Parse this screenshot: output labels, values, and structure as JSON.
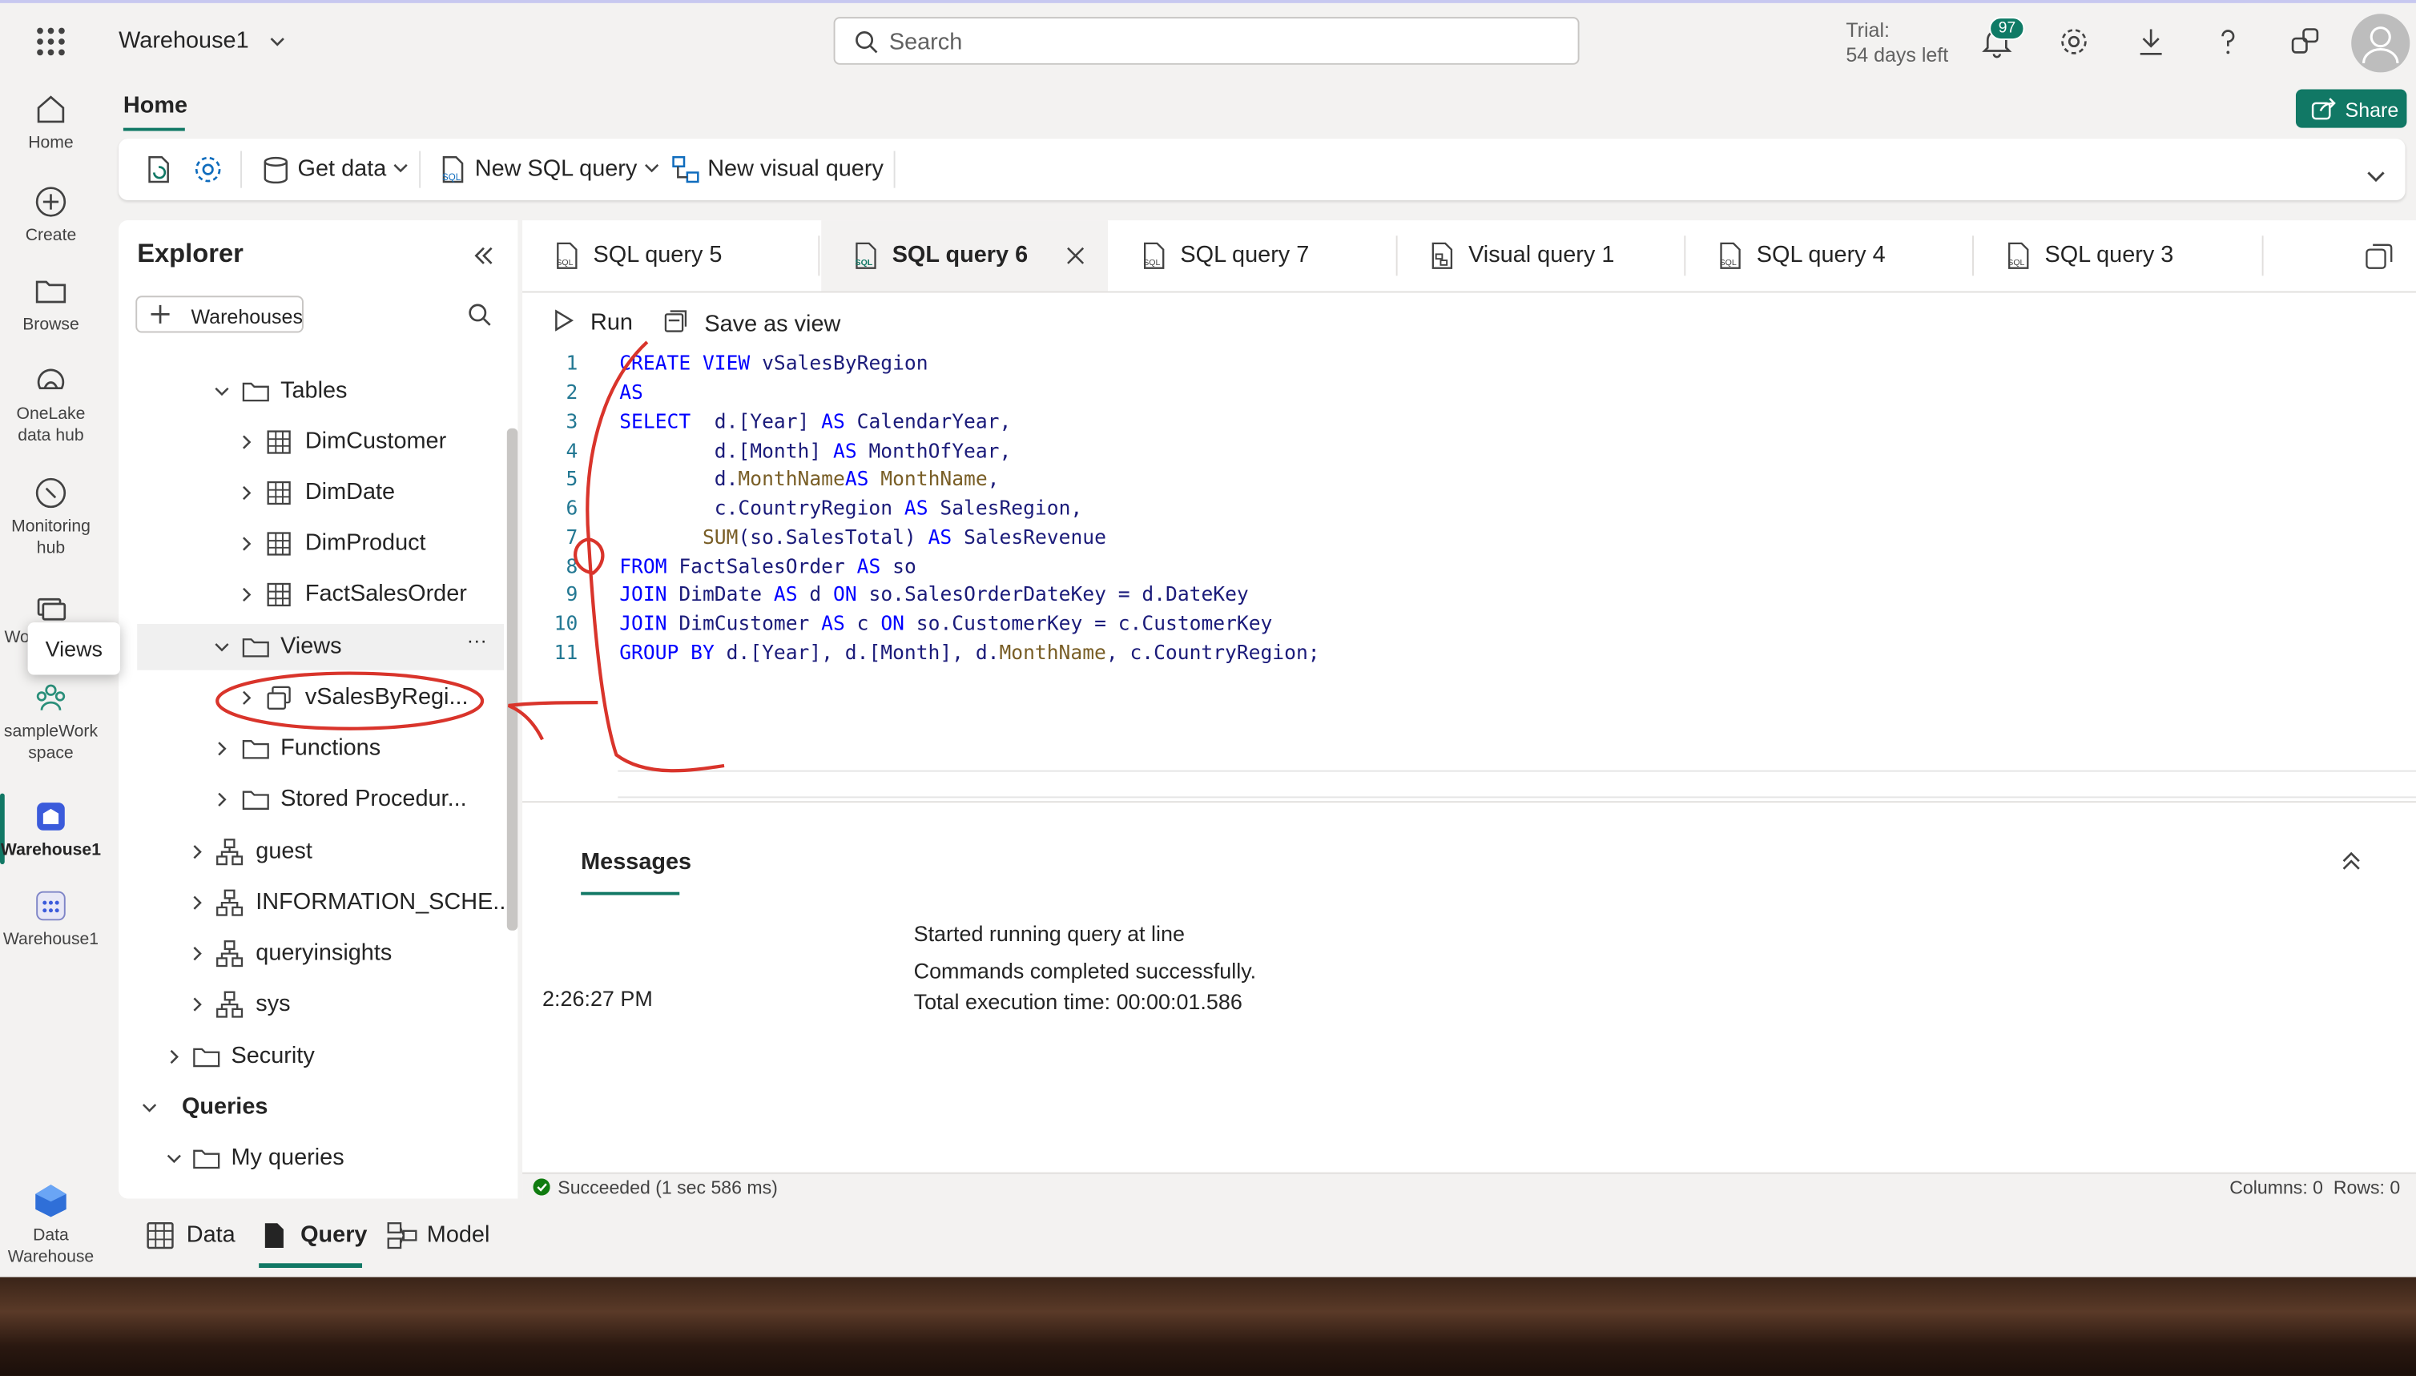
{
  "topbar": {
    "workspace": "Warehouse1",
    "search_placeholder": "Search",
    "trial_line1": "Trial:",
    "trial_line2": "54 days left",
    "notification_count": "97"
  },
  "rail": {
    "items": [
      {
        "label": "Home"
      },
      {
        "label": "Create"
      },
      {
        "label": "Browse"
      },
      {
        "label1": "OneLake",
        "label2": "data hub"
      },
      {
        "label1": "Monitoring",
        "label2": "hub"
      },
      {
        "label": "Wo"
      },
      {
        "label1": "sampleWork",
        "label2": "space"
      },
      {
        "label": "Warehouse1"
      },
      {
        "label": "Warehouse1"
      },
      {
        "label1": "Data",
        "label2": "Warehouse"
      }
    ],
    "tooltip": "Views"
  },
  "ribbon": {
    "tab": "Home",
    "share": "Share",
    "get_data": "Get data",
    "new_sql": "New SQL query",
    "new_visual": "New visual query"
  },
  "explorer": {
    "title": "Explorer",
    "add_button": "Warehouses",
    "tree": [
      {
        "label": "Tables"
      },
      {
        "label": "DimCustomer"
      },
      {
        "label": "DimDate"
      },
      {
        "label": "DimProduct"
      },
      {
        "label": "FactSalesOrder"
      },
      {
        "label": "Views"
      },
      {
        "label": "vSalesByRegi..."
      },
      {
        "label": "Functions"
      },
      {
        "label": "Stored Procedur..."
      },
      {
        "label": "guest"
      },
      {
        "label": "INFORMATION_SCHE..."
      },
      {
        "label": "queryinsights"
      },
      {
        "label": "sys"
      },
      {
        "label": "Security"
      },
      {
        "label": "Queries"
      },
      {
        "label": "My queries"
      }
    ]
  },
  "tabs": [
    {
      "label": "SQL query 5"
    },
    {
      "label": "SQL query 6"
    },
    {
      "label": "SQL query 7"
    },
    {
      "label": "Visual query 1"
    },
    {
      "label": "SQL query 4"
    },
    {
      "label": "SQL query 3"
    }
  ],
  "editor": {
    "run": "Run",
    "save_as_view": "Save as view",
    "line_numbers": [
      "1",
      "2",
      "3",
      "4",
      "5",
      "6",
      "7",
      "8",
      "9",
      "10",
      "11"
    ]
  },
  "messages": {
    "tab": "Messages",
    "time": "2:26:27 PM",
    "line1": "Started running query at line",
    "line2": "Commands completed successfully.",
    "line3": "Total execution time: 00:00:01.586"
  },
  "status": {
    "left": "Succeeded (1 sec 586 ms)",
    "right": "Columns: 0  Rows: 0"
  },
  "bottom_tabs": [
    {
      "label": "Data"
    },
    {
      "label": "Query"
    },
    {
      "label": "Model"
    }
  ],
  "colors": {
    "accent": "#117865",
    "annotation": "#d9342b"
  }
}
